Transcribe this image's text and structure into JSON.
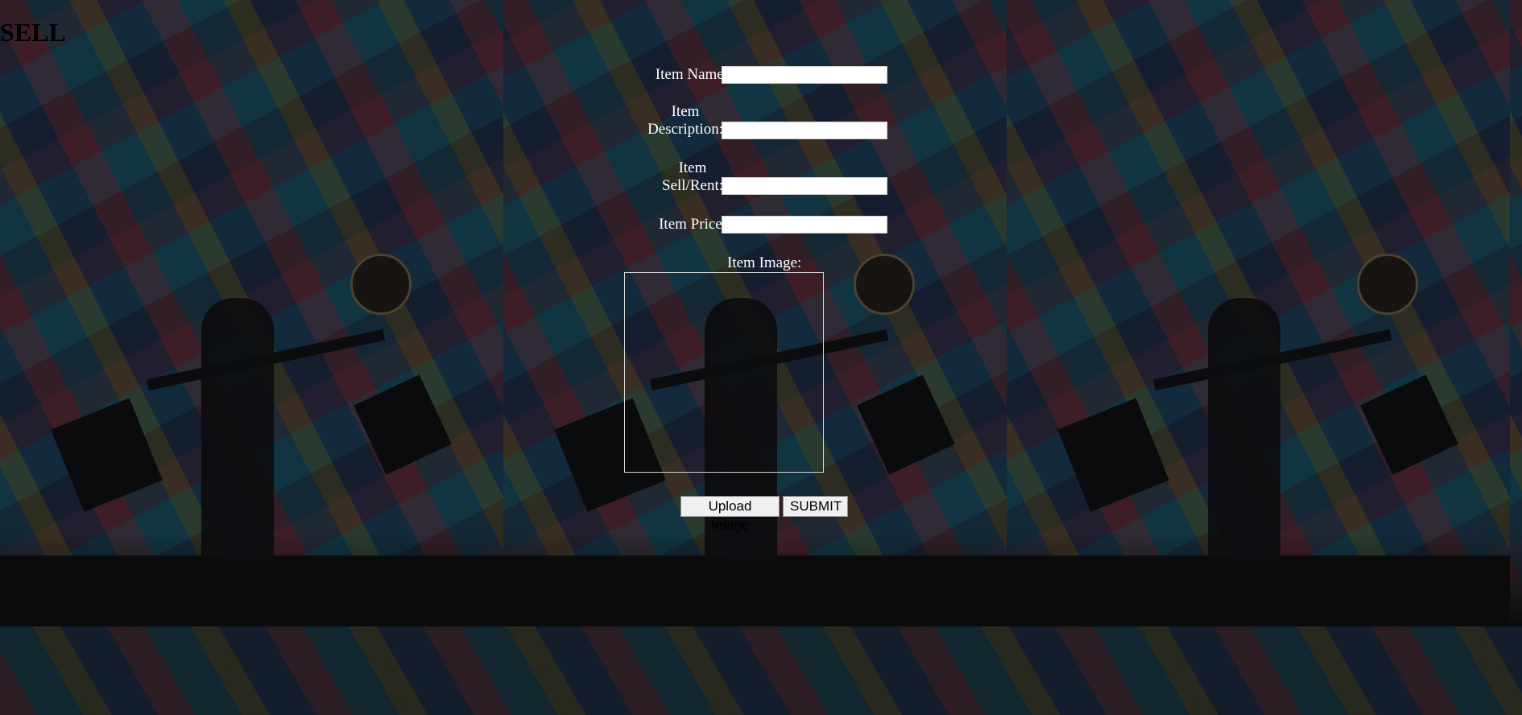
{
  "page": {
    "title": "SELL"
  },
  "form": {
    "item_name": {
      "label": "Item Name:",
      "value": ""
    },
    "item_description": {
      "label_line1": "Item",
      "label_line2": "Description:",
      "value": ""
    },
    "item_sell_rent": {
      "label_line1": "Item",
      "label_line2": "Sell/Rent:",
      "value": ""
    },
    "item_price": {
      "label": "Item Price:",
      "value": ""
    },
    "item_image": {
      "label": "Item Image:"
    }
  },
  "buttons": {
    "upload_label": "Upload Image",
    "submit_label": "SUBMIT"
  }
}
